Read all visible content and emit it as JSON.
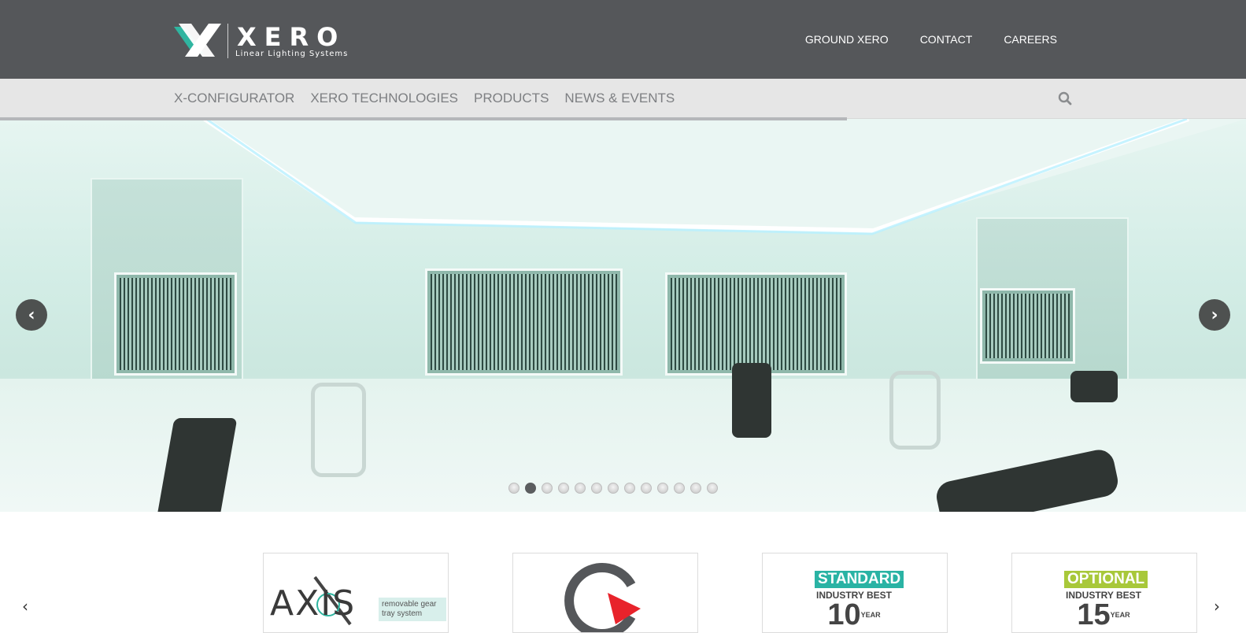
{
  "brand": {
    "name": "XERO",
    "tagline": "Linear Lighting Systems",
    "accent_color": "#2fb5a0"
  },
  "top_nav": {
    "links": [
      "GROUND XERO",
      "CONTACT",
      "CAREERS"
    ]
  },
  "main_nav": {
    "items": [
      "X-CONFIGURATOR",
      "XERO TECHNOLOGIES",
      "PRODUCTS",
      "NEWS & EVENTS"
    ],
    "search_icon": "search-icon"
  },
  "slider": {
    "progress": 0.68,
    "prev_icon": "chevron-left-icon",
    "next_icon": "chevron-right-icon",
    "total_slides": 13,
    "active_slide": 2,
    "prev_glyph": "‹",
    "next_glyph": "›"
  },
  "products": {
    "prev_glyph": "‹",
    "next_glyph": "›",
    "cards": [
      {
        "kind": "axis",
        "title": "AXIS",
        "tag": "removable gear tray system"
      },
      {
        "kind": "logo",
        "title": ""
      },
      {
        "kind": "warranty",
        "badge": "STANDARD",
        "line": "INDUSTRY BEST",
        "number": "10",
        "unit": "YEAR",
        "color": "#2ab3a4"
      },
      {
        "kind": "warranty",
        "badge": "OPTIONAL",
        "line": "INDUSTRY BEST",
        "number": "15",
        "unit": "YEAR",
        "color": "#a8c83a"
      }
    ]
  }
}
